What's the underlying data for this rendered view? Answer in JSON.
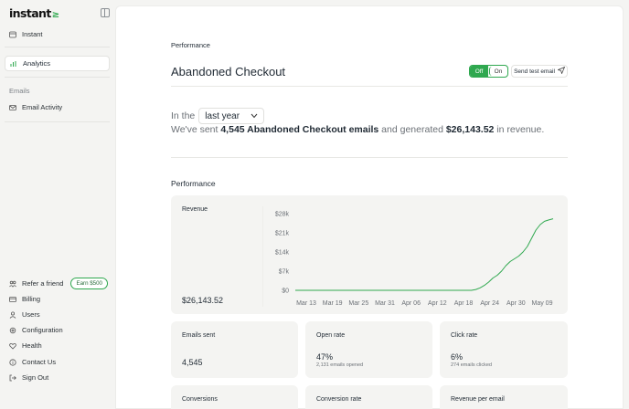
{
  "brand": {
    "logo_text": "instant",
    "logo_mark": "≥"
  },
  "sidebar": {
    "top_items": [
      {
        "label": "Instant",
        "icon": "store-icon"
      },
      {
        "label": "Analytics",
        "icon": "analytics-icon",
        "active": true
      }
    ],
    "section_label": "Emails",
    "email_items": [
      {
        "label": "Email Activity",
        "icon": "mail-icon"
      }
    ],
    "bottom_items": [
      {
        "label": "Refer a friend",
        "icon": "people-icon",
        "badge": "Earn $500"
      },
      {
        "label": "Billing",
        "icon": "card-icon"
      },
      {
        "label": "Users",
        "icon": "user-icon"
      },
      {
        "label": "Configuration",
        "icon": "settings-icon"
      },
      {
        "label": "Health",
        "icon": "heart-icon"
      },
      {
        "label": "Contact Us",
        "icon": "info-icon"
      },
      {
        "label": "Sign Out",
        "icon": "logout-icon"
      }
    ]
  },
  "header": {
    "section": "Performance",
    "title": "Abandoned Checkout",
    "toggle": {
      "off_label": "Off",
      "on_label": "On",
      "state": "off"
    },
    "send_test_label": "Send test email"
  },
  "filter": {
    "prefix": "In the",
    "selected": "last year"
  },
  "summary": {
    "part1": "We've sent ",
    "emails_count": "4,545 Abandoned Checkout emails",
    "part2": " and generated ",
    "revenue": "$26,143.52",
    "part3": " in revenue."
  },
  "performance": {
    "heading": "Performance",
    "revenue_card": {
      "label": "Revenue",
      "value": "$26,143.52"
    },
    "cards": [
      {
        "label": "Emails sent",
        "value": "4,545",
        "sub": ""
      },
      {
        "label": "Open rate",
        "value": "47%",
        "sub": "2,131 emails opened"
      },
      {
        "label": "Click rate",
        "value": "6%",
        "sub": "274 emails clicked"
      },
      {
        "label": "Conversions",
        "value": "",
        "sub": ""
      },
      {
        "label": "Conversion rate",
        "value": "",
        "sub": ""
      },
      {
        "label": "Revenue per email",
        "value": "",
        "sub": ""
      }
    ]
  },
  "chart_data": {
    "type": "line",
    "x_tick_labels": [
      "Mar 13",
      "Mar 19",
      "Mar 25",
      "Mar 31",
      "Apr 06",
      "Apr 12",
      "Apr 18",
      "Apr 24",
      "Apr 30",
      "May 09"
    ],
    "y_tick_labels": [
      "$0",
      "$7k",
      "$14k",
      "$21k",
      "$28k"
    ],
    "ylim": [
      0,
      28000
    ],
    "x_range_days": [
      0,
      60
    ],
    "series": [
      {
        "color": "#2fa84f",
        "points": [
          [
            0,
            0
          ],
          [
            6,
            0
          ],
          [
            12,
            0
          ],
          [
            18,
            0
          ],
          [
            24,
            0
          ],
          [
            30,
            0
          ],
          [
            36,
            0
          ],
          [
            41,
            0
          ],
          [
            42,
            300
          ],
          [
            43,
            900
          ],
          [
            44,
            1800
          ],
          [
            45,
            3000
          ],
          [
            46,
            4500
          ],
          [
            47,
            5500
          ],
          [
            48,
            7000
          ],
          [
            49,
            9000
          ],
          [
            50,
            10500
          ],
          [
            51,
            11500
          ],
          [
            52,
            12500
          ],
          [
            53,
            14000
          ],
          [
            54,
            16000
          ],
          [
            55,
            19000
          ],
          [
            56,
            22000
          ],
          [
            57,
            24000
          ],
          [
            58,
            25200
          ],
          [
            59,
            25700
          ],
          [
            60,
            26143
          ]
        ]
      }
    ],
    "grid": false,
    "legend": "none"
  }
}
